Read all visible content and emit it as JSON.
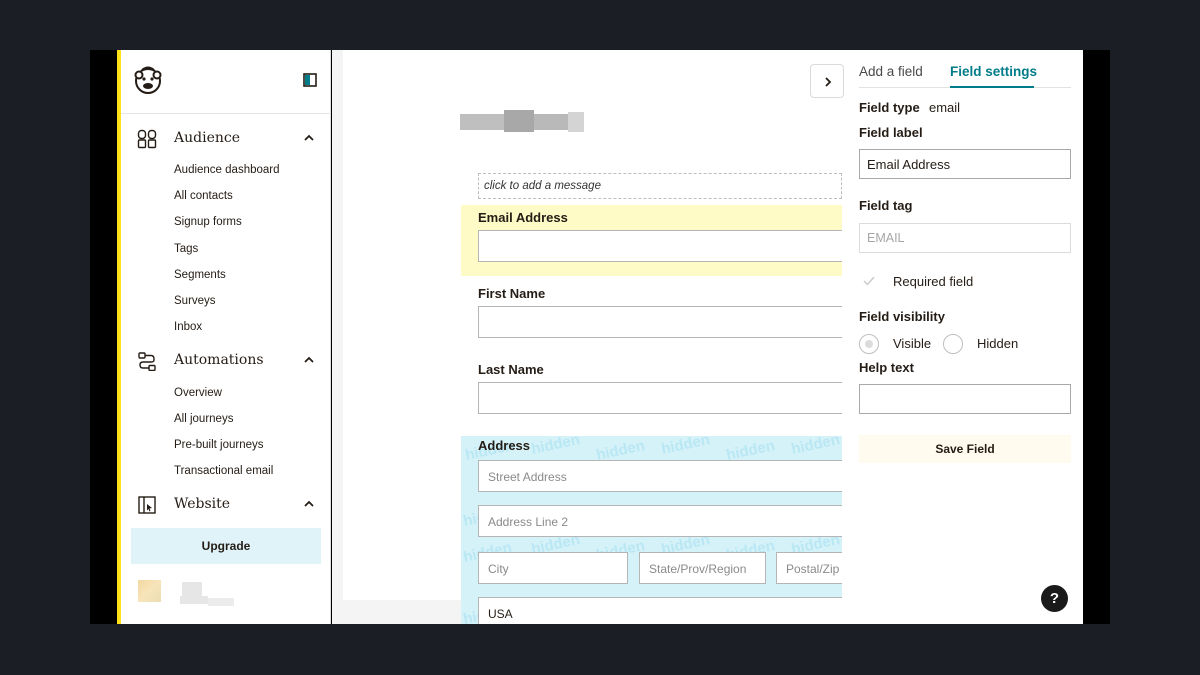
{
  "sidebar": {
    "sections": [
      {
        "label": "Audience",
        "icon": "audience-icon",
        "items": [
          "Audience dashboard",
          "All contacts",
          "Signup forms",
          "Tags",
          "Segments",
          "Surveys",
          "Inbox"
        ]
      },
      {
        "label": "Automations",
        "icon": "automations-icon",
        "items": [
          "Overview",
          "All journeys",
          "Pre-built journeys",
          "Transactional email"
        ]
      },
      {
        "label": "Website",
        "icon": "website-icon",
        "items": []
      }
    ],
    "upgrade_label": "Upgrade"
  },
  "form": {
    "message_placeholder": "click to add a message",
    "fields": [
      {
        "label": "Email Address"
      },
      {
        "label": "First Name"
      },
      {
        "label": "Last Name"
      },
      {
        "label": "Address"
      }
    ],
    "address": {
      "street": "Street Address",
      "line2": "Address Line 2",
      "city": "City",
      "state": "State/Prov/Region",
      "zip": "Postal/Zip",
      "country": "USA"
    },
    "hidden_watermark": "hidden"
  },
  "panel": {
    "tabs": {
      "add": "Add a field",
      "settings": "Field settings"
    },
    "field_type_label": "Field type",
    "field_type_value": "email",
    "field_label_label": "Field label",
    "field_label_value": "Email Address",
    "field_tag_label": "Field tag",
    "field_tag_value": "EMAIL",
    "required_label": "Required field",
    "visibility_label": "Field visibility",
    "visibility_options": [
      "Visible",
      "Hidden"
    ],
    "visibility_selected": "Visible",
    "help_text_label": "Help text",
    "help_text_value": "",
    "save_label": "Save Field",
    "help_button": "?"
  },
  "colors": {
    "accent_teal": "#007c89",
    "brand_yellow": "#ffe01b",
    "hidden_field_bg": "#d5f2f9",
    "selected_field_bg": "#fffbc7"
  }
}
